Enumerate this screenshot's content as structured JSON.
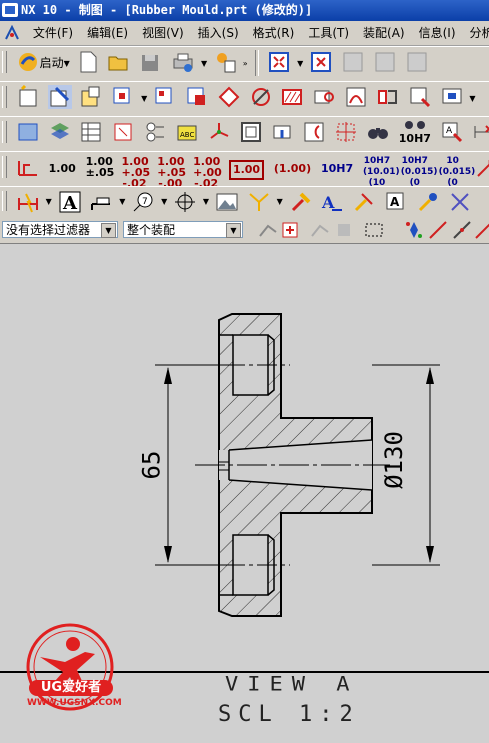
{
  "window": {
    "title": "NX 10 - 制图 - [Rubber Mould.prt (修改的)]"
  },
  "menu": {
    "items": [
      "文件(F)",
      "编辑(E)",
      "视图(V)",
      "插入(S)",
      "格式(R)",
      "工具(T)",
      "装配(A)",
      "信息(I)",
      "分析"
    ]
  },
  "toolbar": {
    "start_label": "启动",
    "tolerance_labels": [
      "1.00",
      "1.00 ±.05",
      "1.00 +.05 -.02",
      "1.00 +.05 -.00",
      "1.00 +.00 -.02",
      "1.00",
      "(1.00)",
      "10H7",
      "10H7 (10.01) (10",
      "10H7 (0.015) (0",
      "10 (0.015) (0"
    ],
    "fit_label": "10H7"
  },
  "filterbar": {
    "filter_value": "没有选择过滤器",
    "scope_value": "整个装配"
  },
  "drawing": {
    "dim_vertical": "65",
    "dim_diameter": "Ø130",
    "view_label": "VIEW A",
    "scale_label": "SCL 1:2"
  },
  "watermark": {
    "brand": "UG爱好者",
    "url": "WWW.UGSNX.COM"
  },
  "colors": {
    "titlebar": "#0b3fa8",
    "chrome": "#d4d0c8",
    "canvas": "#d0d0d0",
    "watermark": "#e02020"
  }
}
